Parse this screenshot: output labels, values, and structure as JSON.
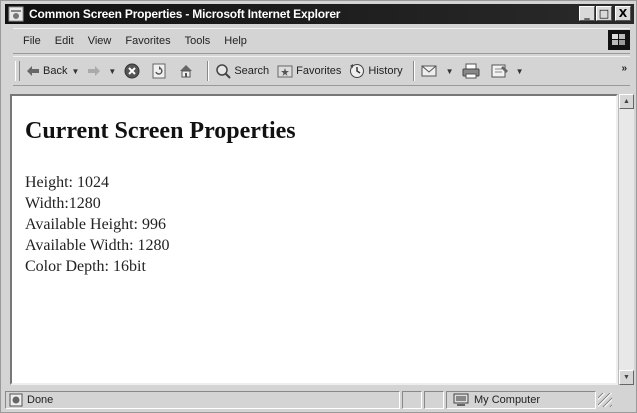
{
  "window": {
    "title": "Common Screen Properties - Microsoft Internet Explorer",
    "minimize_label": "_",
    "maximize_label": "□",
    "close_label": "X"
  },
  "menu": {
    "items": [
      "File",
      "Edit",
      "View",
      "Favorites",
      "Tools",
      "Help"
    ]
  },
  "toolbar": {
    "back_label": "Back",
    "search_label": "Search",
    "favorites_label": "Favorites",
    "history_label": "History",
    "more_label": "»"
  },
  "page": {
    "heading": "Current Screen Properties",
    "lines": [
      "Height: 1024",
      "Width:1280",
      "Available Height: 996",
      "Available Width: 1280",
      "Color Depth: 16bit"
    ]
  },
  "status": {
    "text": "Done",
    "zone": "My Computer"
  },
  "icons": {
    "app": "ie-page-icon",
    "back": "back-arrow-icon",
    "forward": "forward-arrow-icon",
    "stop": "stop-icon",
    "refresh": "refresh-icon",
    "home": "home-icon",
    "search": "search-icon",
    "favorites": "favorites-icon",
    "history": "history-icon",
    "mail": "mail-icon",
    "print": "print-icon",
    "edit": "edit-icon",
    "ie_logo": "windows-logo-icon",
    "status_page": "page-done-icon",
    "zone": "my-computer-icon"
  }
}
